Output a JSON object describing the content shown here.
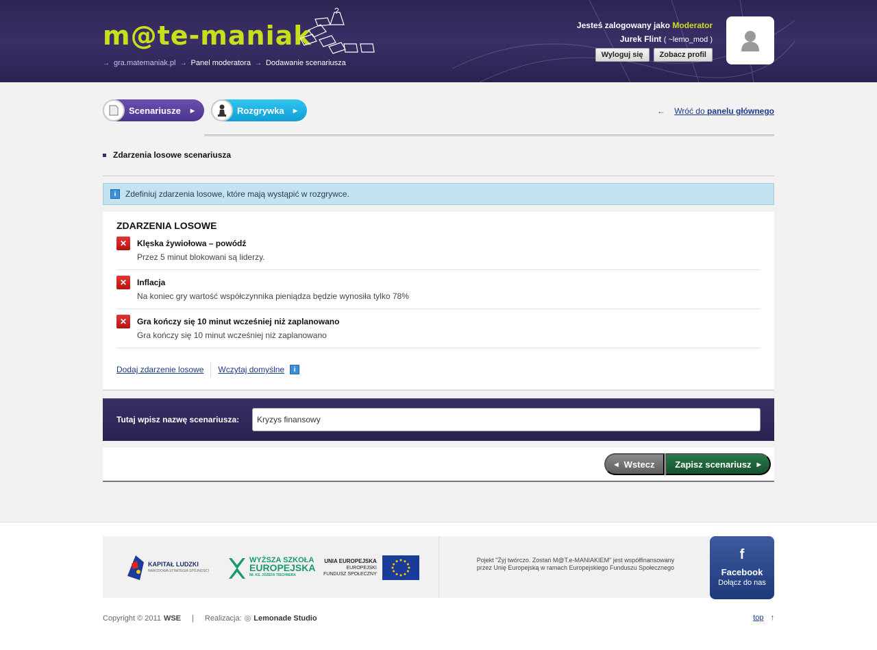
{
  "header": {
    "logo_text": "m@te-maniak",
    "breadcrumb": [
      "gra.matemaniak.pl",
      "Panel moderatora",
      "Dodawanie scenariusza"
    ],
    "user_prefix": "Jesteś zalogowany jako",
    "user_role": "Moderator",
    "user_name": "Jurek Flint",
    "user_nick": "( ~lemo_mod )",
    "logout_label": "Wyloguj się",
    "profile_label": "Zobacz profil"
  },
  "nav": {
    "scenarios_label": "Scenariusze",
    "game_label": "Rozgrywka",
    "back_prefix": "Wróć do",
    "back_bold": "panelu głównego"
  },
  "section_title": "Zdarzenia losowe scenariusza",
  "info_text": "Zdefiniuj zdarzenia losowe, które mają wystąpić w rozgrywce.",
  "events": {
    "title": "ZDARZENIA LOSOWE",
    "items": [
      {
        "name": "Klęska żywiołowa – powódź",
        "desc": "Przez 5 minut blokowani są liderzy."
      },
      {
        "name": "Inflacja",
        "desc": "Na koniec gry wartość współczynnika pieniądza będzie wynosiła tylko 78%"
      },
      {
        "name": "Gra kończy się 10 minut wcześniej niż zaplanowano",
        "desc": "Gra kończy się 10 minut wcześniej niż zaplanowano"
      }
    ],
    "add_label": "Dodaj zdarzenie losowe",
    "load_label": "Wczytaj domyślne"
  },
  "name_bar": {
    "label": "Tutaj wpisz nazwę scenariusza:",
    "value": "Kryzys finansowy"
  },
  "actions": {
    "back_label": "Wstecz",
    "save_label": "Zapisz scenariusz"
  },
  "footer": {
    "kl_title": "KAPITAŁ LUDZKI",
    "kl_sub": "NARODOWA STRATEGIA SPÓJNOŚCI",
    "wse_line1": "WYŻSZA SZKOŁA",
    "wse_line2": "EUROPEJSKA",
    "wse_line3": "IM. KS. JÓZEFA TISCHNERA",
    "ue_title": "UNIA EUROPEJSKA",
    "ue_line2": "EUROPEJSKI",
    "ue_line3": "FUNDUSZ SPOŁECZNY",
    "note_line1": "Pojekt \"Żyj twórczo. Zostań M@T.e-MANIAKIEM\" jest współfinansowany",
    "note_line2": "przez Unię Europejską w ramach Europejskiego Funduszu Społecznego",
    "fb_title": "Facebook",
    "fb_sub": "Dołącz do nas",
    "copyright": "Copyright © 2011",
    "copyright_org": "WSE",
    "realizacja": "Realizacja:",
    "studio": "Lemonade Studio",
    "top_label": "top"
  }
}
